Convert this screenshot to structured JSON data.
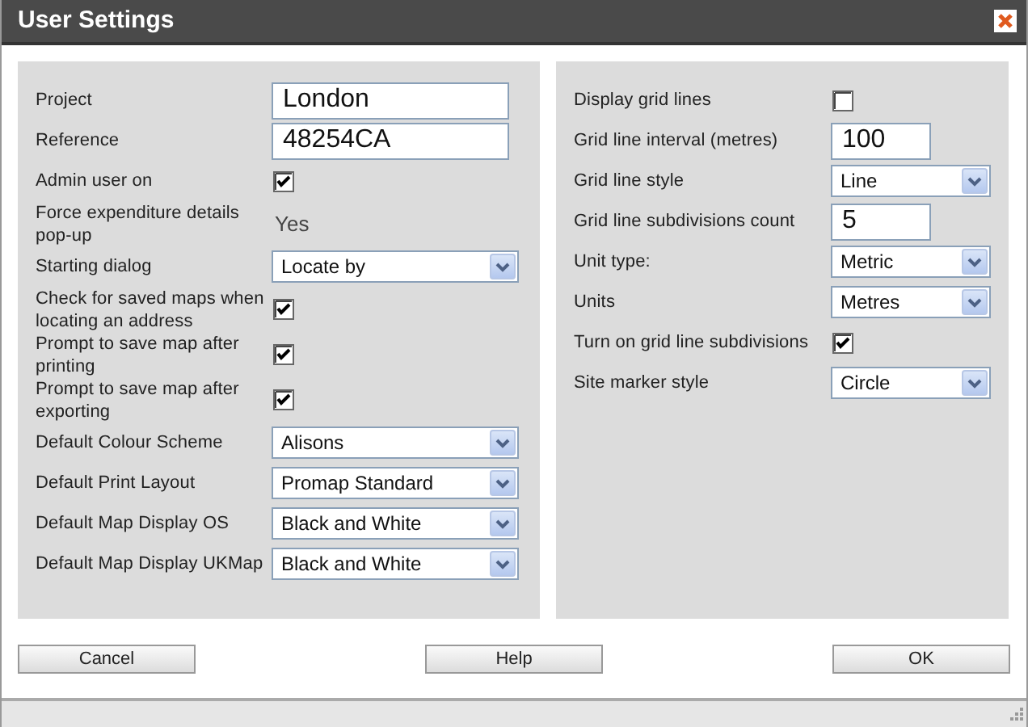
{
  "window": {
    "title": "User Settings"
  },
  "left_settings": [
    {
      "kind": "text",
      "label": "Project",
      "value": "London"
    },
    {
      "kind": "text",
      "label": "Reference",
      "value": "48254CA"
    },
    {
      "kind": "check",
      "label": "Admin user on",
      "checked": true
    },
    {
      "kind": "static",
      "label": "Force expenditure details pop-up",
      "value": "Yes"
    },
    {
      "kind": "select",
      "label": "Starting dialog",
      "value": "Locate by"
    },
    {
      "kind": "check",
      "label": "Check for saved maps when locating an address",
      "checked": true
    },
    {
      "kind": "check",
      "label": "Prompt to save map after printing",
      "checked": true
    },
    {
      "kind": "check",
      "label": "Prompt to save map after exporting",
      "checked": true
    },
    {
      "kind": "select",
      "label": "Default Colour Scheme",
      "value": "Alisons"
    },
    {
      "kind": "select",
      "label": "Default Print Layout",
      "value": "Promap Standard"
    },
    {
      "kind": "select",
      "label": "Default Map Display OS",
      "value": "Black and White"
    },
    {
      "kind": "select",
      "label": "Default Map Display UKMap",
      "value": "Black and White"
    }
  ],
  "right_settings": [
    {
      "kind": "check",
      "label": "Display grid lines",
      "checked": false
    },
    {
      "kind": "text",
      "label": "Grid line interval (metres)",
      "value": "100"
    },
    {
      "kind": "select",
      "label": "Grid line style",
      "value": "Line"
    },
    {
      "kind": "text",
      "label": "Grid line subdivisions count",
      "value": "5"
    },
    {
      "kind": "select",
      "label": "Unit type:",
      "value": "Metric"
    },
    {
      "kind": "select",
      "label": "Units",
      "value": "Metres"
    },
    {
      "kind": "check",
      "label": "Turn on grid line subdivisions",
      "checked": true
    },
    {
      "kind": "select",
      "label": "Site marker style",
      "value": "Circle"
    }
  ],
  "buttons": [
    "Cancel",
    "Help",
    "OK"
  ]
}
